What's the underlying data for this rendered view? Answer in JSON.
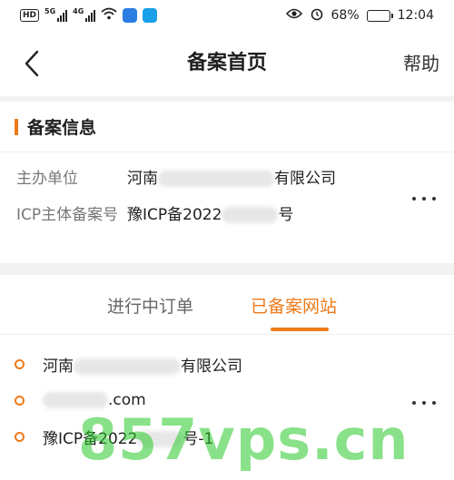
{
  "status_bar": {
    "hd": "HD",
    "net1": "5G",
    "net2": "4G",
    "battery_percent": "68%",
    "time": "12:04",
    "battery_level": 0.68
  },
  "nav": {
    "title": "备案首页",
    "help": "帮助"
  },
  "info_section": {
    "title": "备案信息",
    "rows": [
      {
        "label": "主办单位",
        "value_prefix": "河南",
        "value_suffix": "有限公司"
      },
      {
        "label": "ICP主体备案号",
        "value_prefix": "豫ICP备2022",
        "value_suffix": "号"
      }
    ]
  },
  "tabs": [
    {
      "label": "进行中订单",
      "active": false
    },
    {
      "label": "已备案网站",
      "active": true
    }
  ],
  "site": {
    "items": [
      {
        "prefix": "河南",
        "suffix": "有限公司"
      },
      {
        "prefix": "",
        "suffix": ".com"
      },
      {
        "prefix": "豫ICP备2022",
        "suffix": "号-1"
      }
    ]
  },
  "watermark": "857vps.cn",
  "colors": {
    "accent": "#ee7a1a",
    "watermark": "#28c828"
  }
}
